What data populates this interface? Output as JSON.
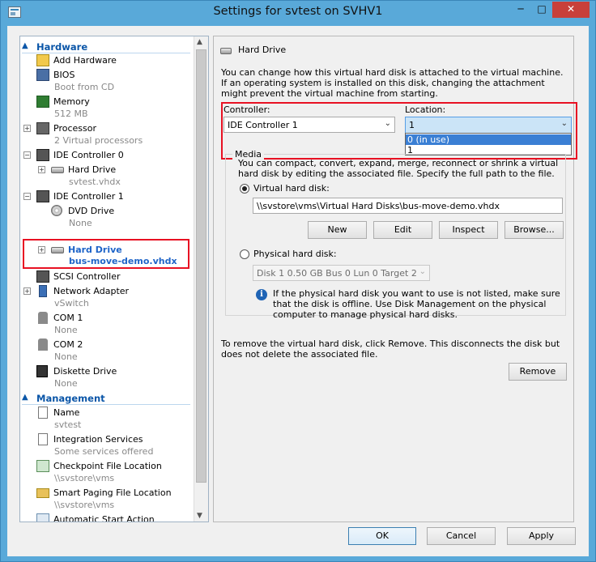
{
  "window": {
    "title": "Settings for svtest on SVHV1",
    "min_label": "─",
    "max_label": "□",
    "close_label": "✕"
  },
  "tree": {
    "hardware_header": "Hardware",
    "management_header": "Management",
    "items": {
      "add_hardware": "Add Hardware",
      "bios": "BIOS",
      "bios_sub": "Boot from CD",
      "memory": "Memory",
      "memory_sub": "512 MB",
      "processor": "Processor",
      "processor_sub": "2 Virtual processors",
      "ide0": "IDE Controller 0",
      "hdd0": "Hard Drive",
      "hdd0_sub": "svtest.vhdx",
      "ide1": "IDE Controller 1",
      "dvd": "DVD Drive",
      "dvd_sub": "None",
      "hdd1": "Hard Drive",
      "hdd1_sub": "bus-move-demo.vhdx",
      "scsi": "SCSI Controller",
      "net": "Network Adapter",
      "net_sub": "vSwitch",
      "com1": "COM 1",
      "com1_sub": "None",
      "com2": "COM 2",
      "com2_sub": "None",
      "diskette": "Diskette Drive",
      "diskette_sub": "None",
      "name": "Name",
      "name_sub": "svtest",
      "integration": "Integration Services",
      "integration_sub": "Some services offered",
      "checkpoint": "Checkpoint File Location",
      "checkpoint_sub": "\\\\svstore\\vms",
      "paging": "Smart Paging File Location",
      "paging_sub": "\\\\svstore\\vms",
      "autostart": "Automatic Start Action"
    }
  },
  "pane": {
    "header": "Hard Drive",
    "intro": "You can change how this virtual hard disk is attached to the virtual machine. If an operating system is installed on this disk, changing the attachment might prevent the virtual machine from starting.",
    "controller_label": "Controller:",
    "controller_value": "IDE Controller 1",
    "location_label": "Location:",
    "location_value": "1",
    "location_options": [
      "0 (in use)",
      "1"
    ],
    "media_title": "Media",
    "media_desc": "You can compact, convert, expand, merge, reconnect or shrink a virtual hard disk by editing the associated file. Specify the full path to the file.",
    "vhd_label": "Virtual hard disk:",
    "vhd_path": "\\\\svstore\\vms\\Virtual Hard Disks\\bus-move-demo.vhdx",
    "btn_new": "New",
    "btn_edit": "Edit",
    "btn_inspect": "Inspect",
    "btn_browse": "Browse...",
    "phys_label": "Physical hard disk:",
    "phys_value": "Disk 1 0.50 GB Bus 0 Lun 0 Target 2",
    "phys_info": "If the physical hard disk you want to use is not listed, make sure that the disk is offline. Use Disk Management on the physical computer to manage physical hard disks.",
    "remove_text": "To remove the virtual hard disk, click Remove. This disconnects the disk but does not delete the associated file.",
    "btn_remove": "Remove"
  },
  "footer": {
    "ok": "OK",
    "cancel": "Cancel",
    "apply": "Apply"
  }
}
